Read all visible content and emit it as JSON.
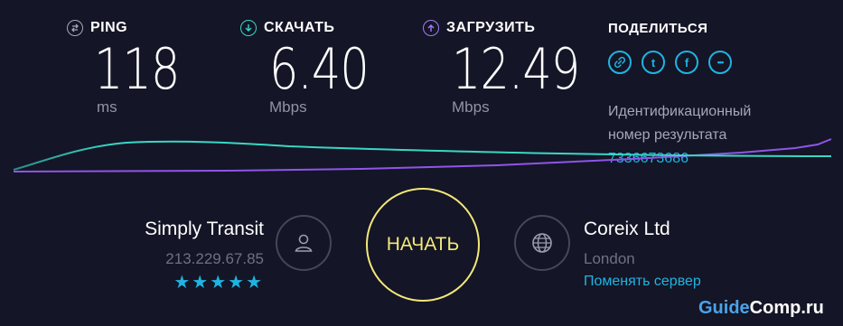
{
  "metrics": {
    "ping": {
      "label": "PING",
      "value": "118",
      "unit": "ms",
      "color": "#a6a8b8"
    },
    "download": {
      "label": "СКАЧАТЬ",
      "value": "6.40",
      "unit": "Mbps",
      "color": "#38d7c5"
    },
    "upload": {
      "label": "ЗАГРУЗИТЬ",
      "value": "12.49",
      "unit": "Mbps",
      "color": "#a27cf4"
    }
  },
  "share": {
    "title": "ПОДЕЛИТЬСЯ",
    "icons": [
      "link-icon",
      "twitter-icon",
      "facebook-icon",
      "more-icon"
    ],
    "twitter_glyph": "t",
    "facebook_glyph": "f",
    "more_glyph": "•••",
    "result_label_line1": "Идентификационный",
    "result_label_line2": "номер результата",
    "result_id": "7336673686"
  },
  "provider": {
    "name": "Simply Transit",
    "ip": "213.229.67.85",
    "rating": 5,
    "stars": "★★★★★"
  },
  "start_button": {
    "label": "НАЧАТЬ",
    "color": "#f2e87a"
  },
  "server": {
    "name": "Coreix Ltd",
    "location": "London",
    "change_label": "Поменять сервер"
  },
  "watermark": {
    "prefix": "Guide",
    "suffix": "Comp.ru"
  },
  "colors": {
    "background": "#141526",
    "accent": "#1fb4e2",
    "download_line": "#38d7c5",
    "upload_line": "#8f55e9"
  }
}
